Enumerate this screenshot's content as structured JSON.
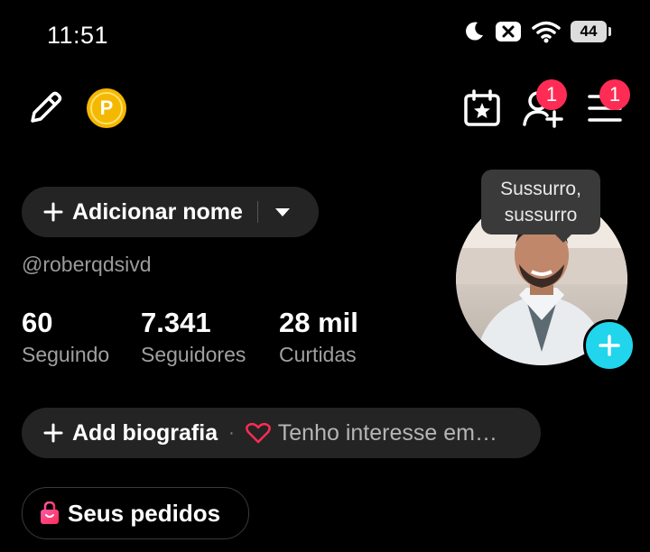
{
  "status_bar": {
    "time": "11:51",
    "battery": "44"
  },
  "top_bar": {
    "friend_badge": "1",
    "menu_badge": "1",
    "coin_letter": "P"
  },
  "profile": {
    "add_name": "Adicionar nome",
    "handle": "@roberqdsivd",
    "bubble_line1": "Sussurro,",
    "bubble_line2": "sussurro"
  },
  "stats": [
    {
      "value": "60",
      "label": "Seguindo"
    },
    {
      "value": "7.341",
      "label": "Seguidores"
    },
    {
      "value": "28 mil",
      "label": "Curtidas"
    }
  ],
  "bio": {
    "add_label": "Add biografia",
    "separator": "·",
    "interest": "Tenho interesse em…"
  },
  "orders": {
    "label": "Seus pedidos"
  },
  "colors": {
    "accent_red": "#fe2c55",
    "accent_cyan": "#20d5ec",
    "coin": "#f5b800"
  }
}
